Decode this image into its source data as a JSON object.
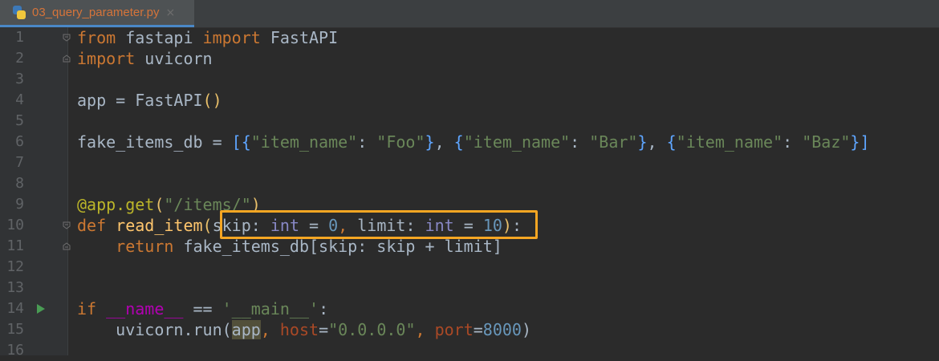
{
  "tab": {
    "filename": "03_query_parameter.py",
    "close": "×",
    "icon": "python-file-icon"
  },
  "lines": [
    {
      "n": "1"
    },
    {
      "n": "2"
    },
    {
      "n": "3"
    },
    {
      "n": "4"
    },
    {
      "n": "5"
    },
    {
      "n": "6"
    },
    {
      "n": "7"
    },
    {
      "n": "8"
    },
    {
      "n": "9"
    },
    {
      "n": "10"
    },
    {
      "n": "11"
    },
    {
      "n": "12"
    },
    {
      "n": "13"
    },
    {
      "n": "14"
    },
    {
      "n": "15"
    },
    {
      "n": "16"
    }
  ],
  "code": {
    "l1": {
      "from": "from",
      "mod": " fastapi ",
      "import": "import",
      "name": " FastAPI"
    },
    "l2": {
      "import": "import",
      "name": " uvicorn"
    },
    "l4": {
      "lhs": "app = FastAPI",
      "open": "(",
      "close": ")"
    },
    "l6": {
      "lhs": "fake_items_db = ",
      "lb": "[",
      "o1": "{",
      "k1": "\"item_name\"",
      "c1": ": ",
      "v1": "\"Foo\"",
      "e1": "}",
      "s1": ", ",
      "o2": "{",
      "k2": "\"item_name\"",
      "c2": ": ",
      "v2": "\"Bar\"",
      "e2": "}",
      "s2": ", ",
      "o3": "{",
      "k3": "\"item_name\"",
      "c3": ": ",
      "v3": "\"Baz\"",
      "e3": "}",
      "rb": "]"
    },
    "l9": {
      "deco": "@app.get",
      "open": "(",
      "path": "\"/items/\"",
      "close": ")"
    },
    "l10": {
      "def": "def",
      "fname": " read_item",
      "open": "(",
      "p1": "skip",
      "c1": ": ",
      "t1": "int",
      "eq1": " = ",
      "d1": "0",
      "sep": ", ",
      "p2": "limit",
      "c2": ": ",
      "t2": "int",
      "eq2": " = ",
      "d2": "10",
      "close": ")",
      "colon": ":"
    },
    "l11": {
      "indent": "    ",
      "ret": "return",
      "rest": " fake_items_db[skip: skip + limit]"
    },
    "l14": {
      "if": "if",
      "dunder": " __name__",
      "eq": " == ",
      "main": "'__main__'",
      "colon": ":"
    },
    "l15": {
      "indent": "    ",
      "call": "uvicorn.run(",
      "app": "app",
      "sep1": ", ",
      "k1": "host",
      "eq1": "=",
      "v1": "\"0.0.0.0\"",
      "sep2": ", ",
      "k2": "port",
      "eq2": "=",
      "v2": "8000",
      "close": ")"
    }
  },
  "colors": {
    "background": "#2b2b2b",
    "keyword": "#cc7832",
    "string": "#6a8759",
    "number": "#6897bb",
    "highlight_box": "#f5a623",
    "tab_text": "#d5743a"
  }
}
